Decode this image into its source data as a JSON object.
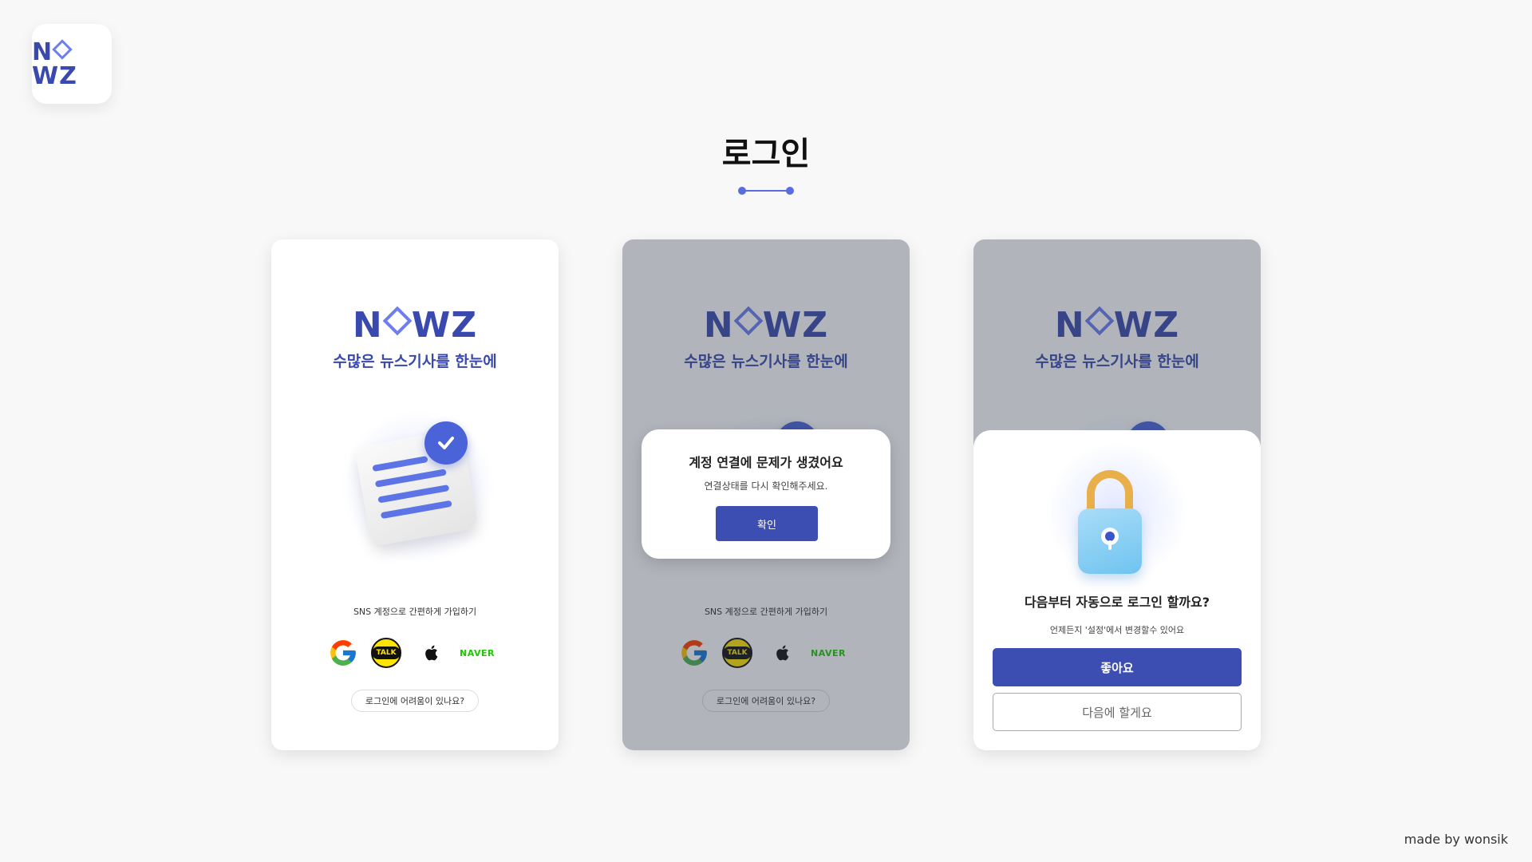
{
  "app": {
    "logo_text_1": "N",
    "logo_text_2": "WZ"
  },
  "page": {
    "title": "로그인"
  },
  "phone_screen": {
    "tagline": "수많은 뉴스기사를 한눈에",
    "sns_prompt": "SNS 계정으로 간편하게 가입하기",
    "sns": {
      "google_icon": "google-icon",
      "kakao_label": "TALK",
      "apple_icon": "apple-icon",
      "naver_label": "NAVER"
    },
    "help_label": "로그인에 어려움이 있나요?"
  },
  "error_dialog": {
    "title": "계정 연결에 문제가 생겼어요",
    "message": "연결상태를 다시 확인해주세요.",
    "confirm_label": "확인"
  },
  "autologin_sheet": {
    "title": "다음부터 자동으로 로그인 할까요?",
    "message": "언제든지 '설정'에서 변경할수 있어요",
    "primary_label": "좋아요",
    "secondary_label": "다음에 할게요"
  },
  "credit": "made by wonsik",
  "colors": {
    "brand": "#3a49ad",
    "accent": "#5a6de0",
    "button": "#3d4eb3",
    "kakao": "#fee500",
    "naver": "#1ec800"
  }
}
